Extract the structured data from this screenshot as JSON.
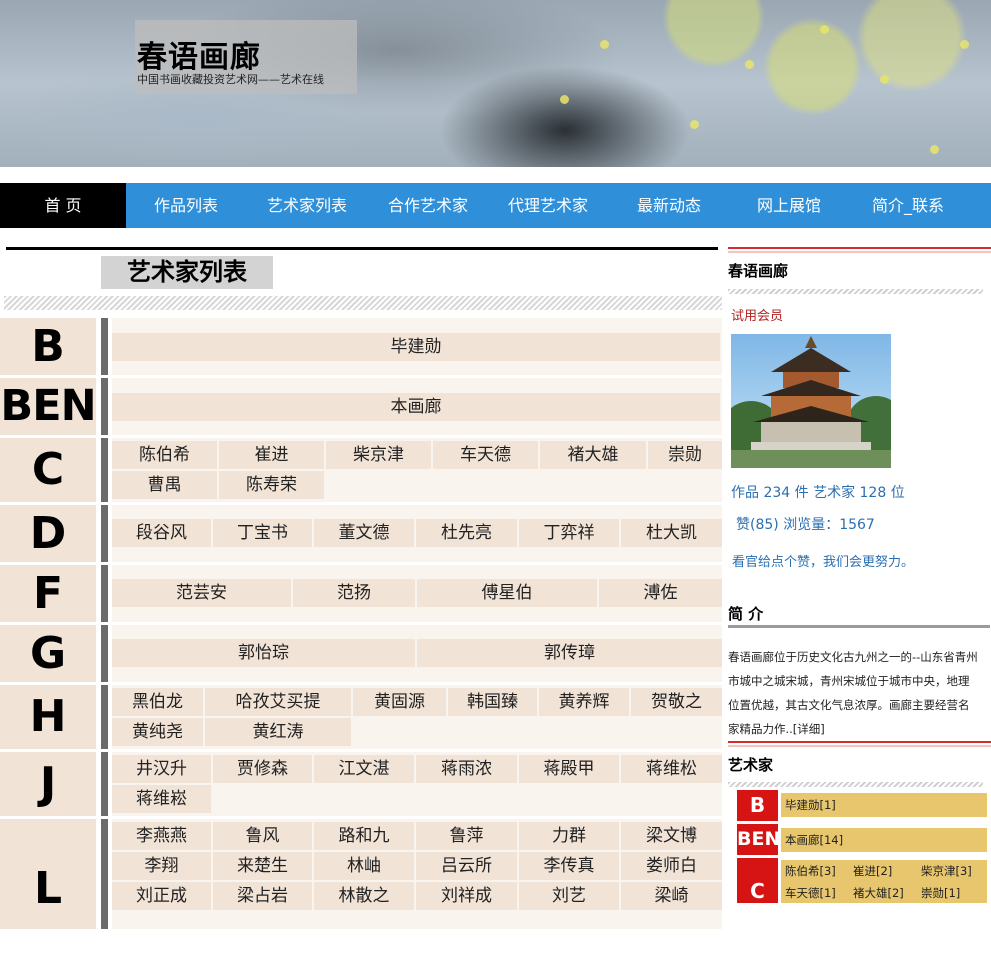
{
  "header": {
    "site_title": "春语画廊",
    "site_subtitle": "中国书画收藏投资艺术网——艺术在线"
  },
  "nav": {
    "items": [
      "首 页",
      "作品列表",
      "艺术家列表",
      "合作艺术家",
      "代理艺术家",
      "最新动态",
      "网上展馆",
      "简介_联系"
    ],
    "active_index": 0
  },
  "main": {
    "section_title": "艺术家列表",
    "groups": [
      {
        "letter": "B",
        "rows": [
          [
            "毕建勋"
          ]
        ]
      },
      {
        "letter": "BEN",
        "rows": [
          [
            "本画廊"
          ]
        ]
      },
      {
        "letter": "C",
        "rows": [
          [
            "陈伯希",
            "崔进",
            "柴京津",
            "车天德",
            "褚大雄",
            "崇勋"
          ],
          [
            "曹禺",
            "陈寿荣"
          ]
        ]
      },
      {
        "letter": "D",
        "rows": [
          [
            "段谷风",
            "丁宝书",
            "董文德",
            "杜先亮",
            "丁弈祥",
            "杜大凯"
          ]
        ]
      },
      {
        "letter": "F",
        "rows": [
          [
            "范芸安",
            "范扬",
            "傅星伯",
            "溥佐"
          ]
        ]
      },
      {
        "letter": "G",
        "rows": [
          [
            "郭怡琮",
            "郭传璋"
          ]
        ]
      },
      {
        "letter": "H",
        "rows": [
          [
            "黑伯龙",
            "哈孜艾买提",
            "黄固源",
            "韩国臻",
            "黄养辉",
            "贺敬之"
          ],
          [
            "黄纯尧",
            "黄红涛"
          ]
        ]
      },
      {
        "letter": "J",
        "rows": [
          [
            "井汉升",
            "贾修森",
            "江文湛",
            "蒋雨浓",
            "蒋殿甲",
            "蒋维松"
          ],
          [
            "蒋维崧"
          ]
        ]
      },
      {
        "letter": "L",
        "rows": [
          [
            "李燕燕",
            "鲁风",
            "路和九",
            "鲁萍",
            "力群",
            "梁文博"
          ],
          [
            "李翔",
            "来楚生",
            "林岫",
            "吕云所",
            "李传真",
            "娄师白"
          ],
          [
            "刘正成",
            "梁占岩",
            "林散之",
            "刘祥成",
            "刘艺",
            "梁崎"
          ]
        ]
      }
    ]
  },
  "sidebar": {
    "gallery_heading": "春语画廊",
    "member_label": "试用会员",
    "stats_text": "作品 234 件  艺术家 128 位",
    "likes_text": "赞(85) 浏览量：1567",
    "thanks_text": "看官给点个赞，我们会更努力。",
    "intro_heading": "简 介",
    "intro_text": " 春语画廊位于历史文化古九州之一的--山东省青州市城中之城宋城，青州宋城位于城市中央，地理位置优越，其古文化气息浓厚。画廊主要经营名家精品力作..[详细]",
    "artists_heading": "艺术家",
    "artist_groups": [
      {
        "letter": "B",
        "names": [
          "毕建勋[1]"
        ]
      },
      {
        "letter": "BEN",
        "names": [
          "本画廊[14]"
        ]
      },
      {
        "letter": "C",
        "names": [
          "陈伯希[3]",
          "崔进[2]",
          "柴京津[3]",
          "车天德[1]",
          "褚大雄[2]",
          "崇勋[1]"
        ]
      }
    ]
  },
  "colors": {
    "nav_blue": "#2f8fd9",
    "nav_active": "#000000",
    "letter_bg": "#f1e3d6",
    "side_letter_red": "#d61414",
    "side_names_gold": "#e7c66e",
    "link_blue": "#2a6fb0"
  }
}
